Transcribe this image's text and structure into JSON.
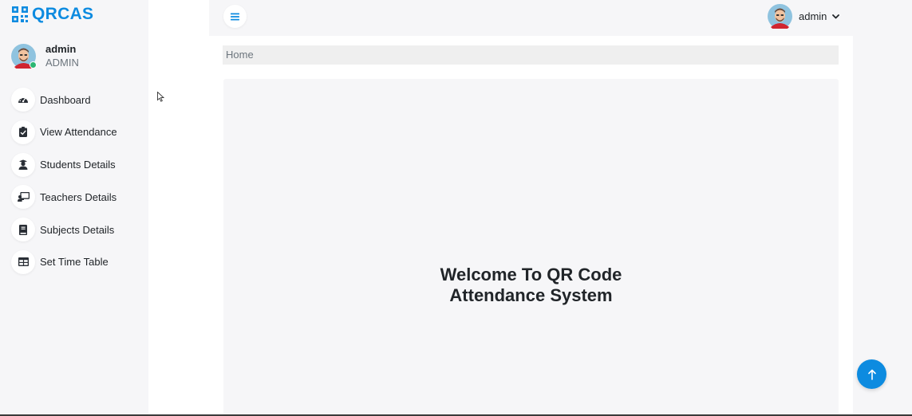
{
  "brand": {
    "name": "QRCAS",
    "icon": "qrcode-icon",
    "color": "#0d8be0"
  },
  "profile": {
    "name": "admin",
    "role": "ADMIN",
    "status": "online"
  },
  "sidebar": {
    "items": [
      {
        "label": "Dashboard",
        "icon": "tachometer-icon"
      },
      {
        "label": "View Attendance",
        "icon": "clipboard-check-icon"
      },
      {
        "label": "Students Details",
        "icon": "user-graduate-icon"
      },
      {
        "label": "Teachers Details",
        "icon": "chalkboard-teacher-icon"
      },
      {
        "label": "Subjects Details",
        "icon": "book-icon"
      },
      {
        "label": "Set Time Table",
        "icon": "table-icon"
      }
    ]
  },
  "header": {
    "menu_icon": "bars-icon",
    "user_name": "admin",
    "user_menu_icon": "chevron-down-icon"
  },
  "breadcrumb": {
    "home": "Home"
  },
  "main": {
    "welcome": "Welcome To QR Code Attendance System"
  },
  "scroll_top": {
    "icon": "arrow-up-icon"
  }
}
